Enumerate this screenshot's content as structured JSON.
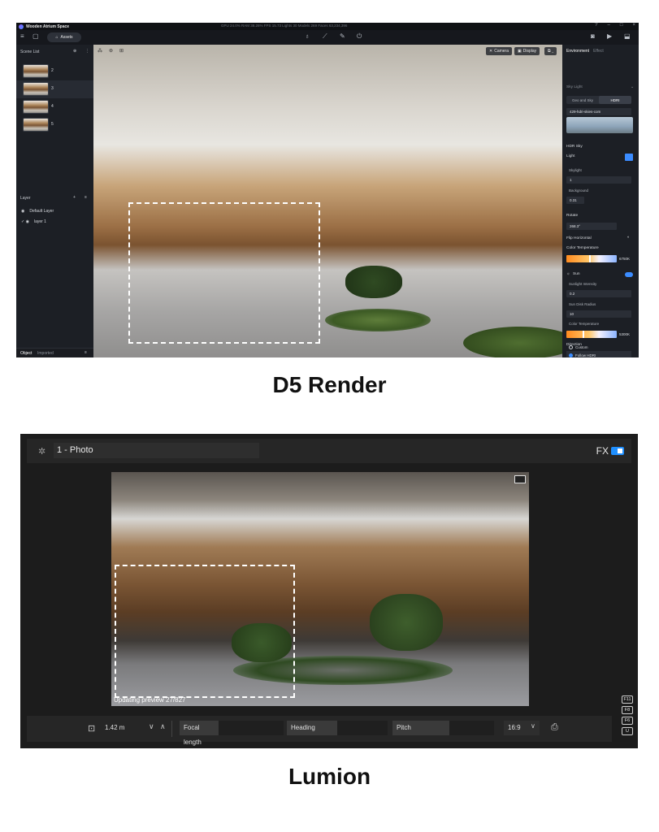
{
  "d5": {
    "project_name": "Wooden Atrium Space",
    "stats": "GPU 24.0%   RAM 38.26%   FPS 15.73   Lights 30   Models 269   Faces 63,234,396",
    "assets_label": "Assets",
    "scene_list_label": "Scene List",
    "scenes": [
      "2",
      "3",
      "4",
      "5"
    ],
    "layer_label": "Layer",
    "layers": [
      "Default Layer",
      "layer 1"
    ],
    "footer_tabs": [
      "Object",
      "Imported"
    ],
    "viewport_buttons": [
      "Camera",
      "Display"
    ],
    "right": {
      "tab_environment": "Environment",
      "tab_effect": "Effect",
      "sky_light": "Sky Light",
      "seg_geo": "Geo and Sky",
      "seg_hdri": "HDRI",
      "hdri_name": "429-hdri-skies-com",
      "hdr_sky": "HDR Sky",
      "light": "Light",
      "skylight": "Skylight",
      "skylight_val": "1",
      "background": "Background",
      "background_val": "0.31",
      "rotate": "Rotate",
      "rotate_val": "268.3°",
      "flip_horizontal": "Flip Horizontal",
      "color_temperature": "Color Temperature",
      "kelvin_sky": "6750K",
      "sun": "Sun",
      "sunlight_intensity": "Sunlight Intensity",
      "sunlight_val": "0.2",
      "sun_disk_radius": "Sun Disk Radius",
      "sun_disk_val": "10",
      "color_temperature_2": "Color Temperature",
      "kelvin_sun": "5300K",
      "direction": "Direction",
      "follow_hdri": "Follow HDRI",
      "custom": "Custom"
    }
  },
  "captions": {
    "d5": "D5 Render",
    "lumion": "Lumion"
  },
  "lumion": {
    "photo_title": "1 - Photo",
    "fx_label": "FX",
    "preview_status": "Updating preview 27/827",
    "height_val": "1.42 m",
    "focal_length": "Focal length",
    "heading": "Heading",
    "pitch": "Pitch",
    "aspect": "16:9",
    "fkeys": [
      "F11",
      "F8",
      "F6",
      "U"
    ]
  },
  "icons": {
    "menu": "menu-icon",
    "file": "file-icon",
    "camera": "camera-icon",
    "video": "video-icon",
    "dropdown": "chevron-down-icon"
  }
}
